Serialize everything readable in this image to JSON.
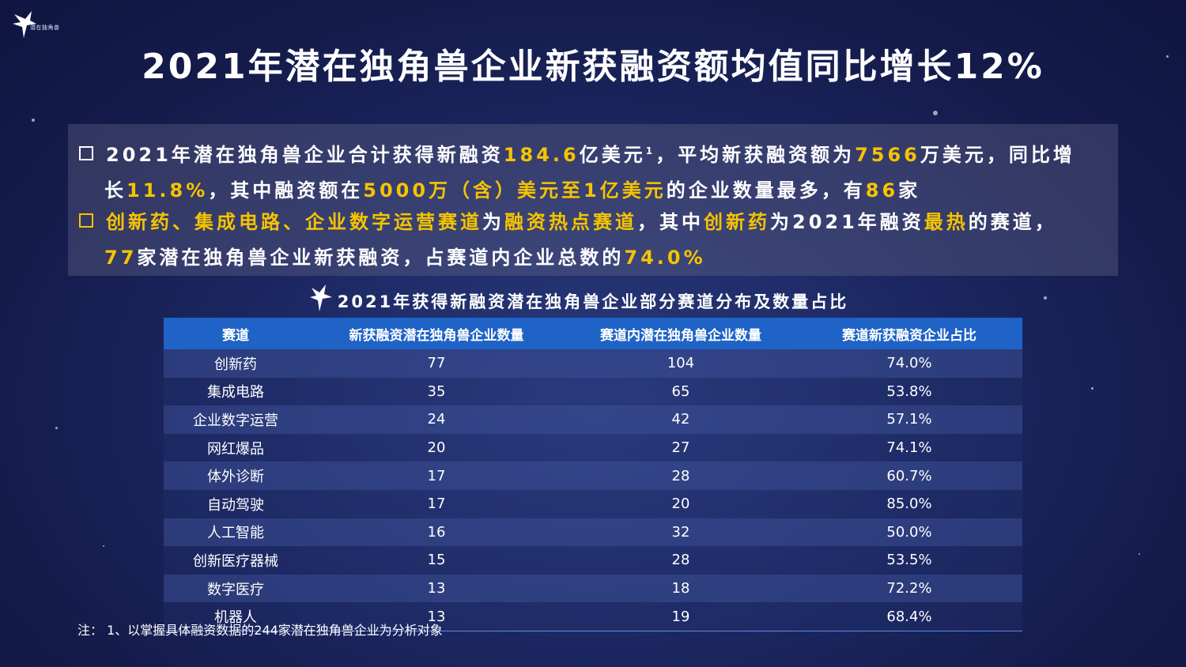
{
  "logo": {
    "text": "潜在独角兽"
  },
  "title": "2021年潜在独角兽企业新获融资额均值同比增长12%",
  "summary": {
    "b1": {
      "t1": "2021年潜在独角兽企业合计获得新融资",
      "v1": "184.6",
      "t2": "亿美元",
      "sup": "1",
      "t3": "，平均新获融资额为",
      "v2": "7566",
      "t4": "万美元，同比增",
      "t5": "长",
      "v3": "11.8%",
      "t6": "，其中融资额在",
      "v4": "5000万（含）美元至1亿美元",
      "t7": "的企业数量最多，有",
      "v5": "86",
      "t8": "家"
    },
    "b2": {
      "h1": "创新药、集成电路、企业数字运营赛道",
      "t1": "为",
      "h2": "融资热点赛道",
      "t2": "，其中",
      "h3": "创新药",
      "t3": "为2021年融资",
      "h4": "最热",
      "t4": "的赛道，",
      "v1": "77",
      "t5": "家潜在独角兽企业新获融资，占赛道内企业总数的",
      "v2": "74.0%"
    }
  },
  "table": {
    "title": "2021年获得新融资潜在独角兽企业部分赛道分布及数量占比",
    "headers": [
      "赛道",
      "新获融资潜在独角兽企业数量",
      "赛道内潜在独角兽企业数量",
      "赛道新获融资企业占比"
    ],
    "rows": [
      [
        "创新药",
        "77",
        "104",
        "74.0%"
      ],
      [
        "集成电路",
        "35",
        "65",
        "53.8%"
      ],
      [
        "企业数字运营",
        "24",
        "42",
        "57.1%"
      ],
      [
        "网红爆品",
        "20",
        "27",
        "74.1%"
      ],
      [
        "体外诊断",
        "17",
        "28",
        "60.7%"
      ],
      [
        "自动驾驶",
        "17",
        "20",
        "85.0%"
      ],
      [
        "人工智能",
        "16",
        "32",
        "50.0%"
      ],
      [
        "创新医疗器械",
        "15",
        "28",
        "53.5%"
      ],
      [
        "数字医疗",
        "13",
        "18",
        "72.2%"
      ],
      [
        "机器人",
        "13",
        "19",
        "68.4%"
      ]
    ]
  },
  "note": "注：  1、以掌握具体融资数据的244家潜在独角兽企业为分析对象",
  "colors": {
    "highlight": "#f5c400",
    "header_blue": "#1f63c7"
  }
}
